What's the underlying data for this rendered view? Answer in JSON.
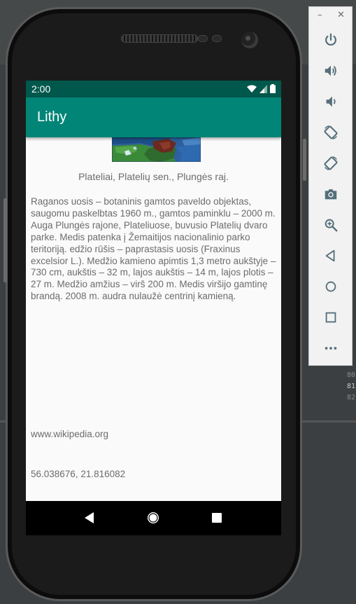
{
  "status_bar": {
    "time": "2:00"
  },
  "app_bar": {
    "title": "Lithy"
  },
  "place": {
    "caption": "Plateliai, Platelių sen., Plungės raj.",
    "description": "Raganos uosis – botaninis gamtos paveldo objektas, saugomu paskelbtas 1960 m., gamtos paminklu – 2000 m. Auga Plungės rajone, Plateliuose, buvusio Platelių dvaro parke. Medis patenka į Žemaitijos nacionalinio parko teritoriją. edžio rūšis – paprastasis uosis (Fraxinus excelsior L.). Medžio kamieno apimtis 1,3 metro aukštyje – 730 cm, aukštis – 32 m, lajos aukštis – 14 m, lajos plotis – 27 m. Medžio amžius – virš 200 m. Medis viršijo gamtinę brandą. 2008 m. audra nulaužė centrinį kamieną.",
    "source": "www.wikipedia.org",
    "coordinates": "56.038676, 21.816082"
  },
  "navigation_bar": {
    "back": "back-icon",
    "home": "home-icon",
    "recents": "recents-icon"
  },
  "emulator_panel": {
    "minimize": "–",
    "close": "✕",
    "controls": [
      "power-icon",
      "volume-up-icon",
      "volume-down-icon",
      "rotate-left-icon",
      "rotate-right-icon",
      "camera-icon",
      "zoom-icon",
      "back-icon",
      "home-icon",
      "overview-icon",
      "more-icon"
    ]
  },
  "background_ide": {
    "lines": [
      "80",
      "81",
      "82"
    ]
  },
  "colors": {
    "status_bar": "#00574b",
    "app_bar": "#008577",
    "content_bg": "#fafafa",
    "text": "#6c6c6c",
    "emulator_icon": "#546e7a"
  }
}
